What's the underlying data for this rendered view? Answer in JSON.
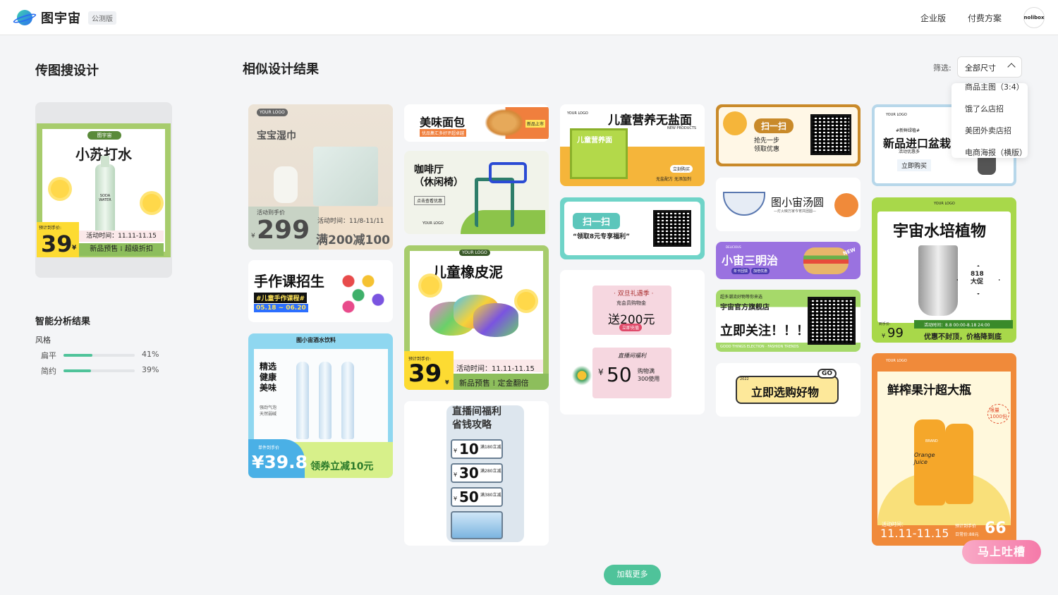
{
  "header": {
    "brand": "图宇宙",
    "badge": "公测版",
    "nav": [
      "企业版",
      "付费方案"
    ],
    "avatar": "nolibox"
  },
  "left": {
    "title": "传图搜设计",
    "poster": {
      "brand_tag": "图宇宙",
      "title": "小苏打水",
      "bottle_text": "SODA WATER",
      "price_label": "预计到手价:",
      "price": "39",
      "currency": "¥",
      "strip1": "活动时间：11.11-11.15",
      "strip2": "新品预售 ⁞ 超级折扣"
    },
    "analysis_title": "智能分析结果",
    "style_label": "风格",
    "styles": [
      {
        "name": "扁平",
        "percent": "41%",
        "value": 0.41
      },
      {
        "name": "简约",
        "percent": "39%",
        "value": 0.39
      }
    ]
  },
  "results": {
    "title": "相似设计结果",
    "filter_label": "筛选:",
    "filter_value": "全部尺寸",
    "dropdown": [
      "商品主图（3:4）",
      "饿了么店招",
      "美团外卖店招",
      "电商海报（横版）"
    ],
    "load_more": "加载更多",
    "feedback": "马上吐槽"
  },
  "cards": {
    "tissue": {
      "logo": "YOUR LOGO",
      "title": "宝宝湿巾",
      "label": "活动到手价",
      "price": "299",
      "currency": "¥",
      "time": "活动时间：11/8-11/11",
      "promo": "满200减100"
    },
    "bread": {
      "title": "美味面包",
      "sub": "优品集汇多好评超卓越",
      "tag": "新品上市"
    },
    "chair": {
      "title": "咖啡厅\n（休闲椅）",
      "tag": "点击查看优惠",
      "logo": "YOUR LOGO"
    },
    "craft": {
      "title": "手作课招生",
      "sub": "#儿童手作课程#",
      "date": "05.18 ~ 06.20"
    },
    "water": {
      "brand": "图小宙酒水饮料",
      "title": "精选\n健康\n美味",
      "sub": "强劲气泡\n天然弱碱",
      "label": "单件到手价",
      "price": "¥39.8",
      "promo": "领券立减10元"
    },
    "noodle": {
      "logo": "YOUR LOGO",
      "title": "儿童营养无盐面",
      "sub": "NEW PRODUCTS",
      "pack": "儿童营养面",
      "button": "立刻购买",
      "note": "无盐配方 无添加剂"
    },
    "clay": {
      "logo": "YOUR LOGO",
      "title": "儿童橡皮泥",
      "label": "预计到手价:",
      "price": "39",
      "currency": "¥",
      "time": "活动时间：11.11-11.15",
      "promo": "新品预售 ⁞ 定金翻倍"
    },
    "live": {
      "title": "直播间福利\n省钱攻略",
      "coupons": [
        {
          "amount": "10",
          "cond": "满180立减"
        },
        {
          "amount": "30",
          "cond": "满280立减"
        },
        {
          "amount": "50",
          "cond": "满380立减"
        }
      ],
      "currency": "¥"
    },
    "scan1": {
      "button": "扫一扫",
      "text": "“领取8元专享福利”"
    },
    "gift": {
      "title": "· 双旦礼遇季 ·",
      "sub": "充会员购物金",
      "big": "送200元",
      "tag": "立即充值",
      "label": "直播间福利",
      "amount": "50",
      "currency": "¥",
      "cond": "购物满\n300使用"
    },
    "honey": {
      "button": "扫一扫",
      "sub": "抢先一步\n领取优惠"
    },
    "tangyuan": {
      "title": "图小宙汤圆",
      "sub": "—灯火映万家今宵共团圆—"
    },
    "sandwich": {
      "tag": "DELICIOUS",
      "title": "小宙三明治",
      "chips": [
        "年卡回馈",
        "加倍优惠"
      ],
      "new": "NEW"
    },
    "store": {
      "top": "超多潮流好物等你来选",
      "name": "宇宙官方旗舰店",
      "follow": "立即关注！！！",
      "bottom": "GOOD THINGS ELECTION · FASHION TRENDS"
    },
    "go": {
      "text": "立即选购好物",
      "badge": "GO",
      "tag": "2022"
    },
    "pot": {
      "logo": "YOUR LOGO",
      "tag": "#新鲜绿植#",
      "title": "新品进口盆栽",
      "sub": "活动优惠多",
      "button": "立即购买"
    },
    "plant": {
      "logo": "YOUR LOGO",
      "title": "宇宙水培植物",
      "badge": "818\n大促",
      "label": "到手价:",
      "price": "99",
      "currency": "¥",
      "time": "活动时间：8.8 00:00-8.18 24:00",
      "promo": "优惠不封顶，价格降到底"
    },
    "juice": {
      "logo": "YOUR LOGO",
      "title": "鲜榨果汁超大瓶",
      "limit": "限量\n1000份",
      "bottle": "Orange\nJuice",
      "brand": "BRAND",
      "time_label": "活动时间：",
      "time": "11.11-11.15",
      "price_label": "预计到手价",
      "old": "日常价:88元",
      "price": "66"
    }
  }
}
